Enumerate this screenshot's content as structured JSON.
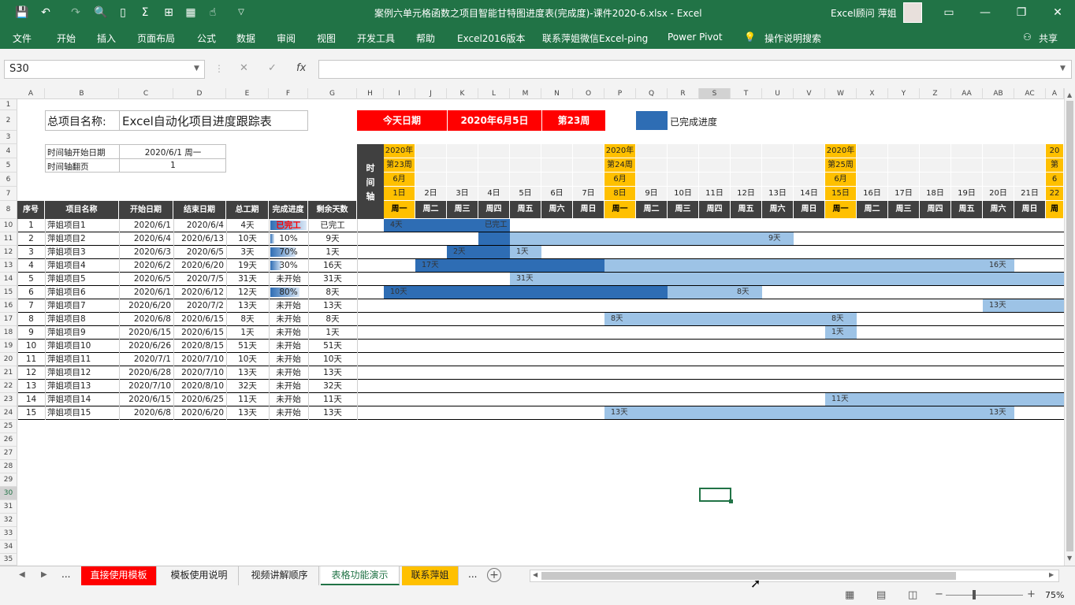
{
  "window": {
    "title": "案例六单元格函数之项目智能甘特图进度表(完成度)-课件2020-6.xlsx  -  Excel",
    "user": "Excel顾问 萍姐"
  },
  "ribbon": {
    "tabs": [
      "文件",
      "开始",
      "插入",
      "页面布局",
      "公式",
      "数据",
      "审阅",
      "视图",
      "开发工具",
      "帮助",
      "Excel2016版本",
      "联系萍姐微信Excel-ping",
      "Power Pivot"
    ],
    "search": "操作说明搜索",
    "share": "共享"
  },
  "formula": {
    "namebox": "S30",
    "fx": "fx",
    "value": ""
  },
  "columns": [
    "A",
    "B",
    "C",
    "D",
    "E",
    "F",
    "G",
    "H",
    "I",
    "J",
    "K",
    "L",
    "M",
    "N",
    "O",
    "P",
    "Q",
    "R",
    "S",
    "T",
    "U",
    "V",
    "W",
    "X",
    "Y",
    "Z",
    "AA",
    "AB",
    "AC",
    "A"
  ],
  "rows": [
    "1",
    "2",
    "3",
    "4",
    "5",
    "6",
    "7",
    "8",
    "10",
    "11",
    "12",
    "13",
    "14",
    "15",
    "16",
    "17",
    "18",
    "19",
    "20",
    "21",
    "22",
    "23",
    "24",
    "25",
    "26",
    "27",
    "28",
    "29",
    "30",
    "31",
    "32",
    "33",
    "34",
    "35"
  ],
  "sheet": {
    "project_label": "总项目名称:",
    "project_name": "Excel自动化项目进度跟踪表",
    "today_label": "今天日期",
    "today_date": "2020年6月5日",
    "today_week": "第23周",
    "legend_label": "已完成进度",
    "start_label": "时间轴开始日期",
    "start_value": "2020/6/1 周一",
    "page_label": "时间轴翻页",
    "page_value": "1",
    "timeline_label": "时\n间\n轴"
  },
  "table": {
    "headers": [
      "序号",
      "项目名称",
      "开始日期",
      "结束日期",
      "总工期",
      "完成进度",
      "剩余天数"
    ],
    "rows": [
      {
        "no": "1",
        "name": "萍姐项目1",
        "start": "2020/6/1",
        "end": "2020/6/4",
        "days": "4天",
        "pct": "已完工",
        "pct_fill": 1.0,
        "remain": "已完工"
      },
      {
        "no": "2",
        "name": "萍姐项目2",
        "start": "2020/6/4",
        "end": "2020/6/13",
        "days": "10天",
        "pct": "10%",
        "pct_fill": 0.1,
        "remain": "9天"
      },
      {
        "no": "3",
        "name": "萍姐项目3",
        "start": "2020/6/3",
        "end": "2020/6/5",
        "days": "3天",
        "pct": "70%",
        "pct_fill": 0.7,
        "remain": "1天"
      },
      {
        "no": "4",
        "name": "萍姐项目4",
        "start": "2020/6/2",
        "end": "2020/6/20",
        "days": "19天",
        "pct": "30%",
        "pct_fill": 0.3,
        "remain": "16天"
      },
      {
        "no": "5",
        "name": "萍姐项目5",
        "start": "2020/6/5",
        "end": "2020/7/5",
        "days": "31天",
        "pct": "未开始",
        "pct_fill": 0,
        "remain": "31天"
      },
      {
        "no": "6",
        "name": "萍姐项目6",
        "start": "2020/6/1",
        "end": "2020/6/12",
        "days": "12天",
        "pct": "80%",
        "pct_fill": 0.8,
        "remain": "8天"
      },
      {
        "no": "7",
        "name": "萍姐项目7",
        "start": "2020/6/20",
        "end": "2020/7/2",
        "days": "13天",
        "pct": "未开始",
        "pct_fill": 0,
        "remain": "13天"
      },
      {
        "no": "8",
        "name": "萍姐项目8",
        "start": "2020/6/8",
        "end": "2020/6/15",
        "days": "8天",
        "pct": "未开始",
        "pct_fill": 0,
        "remain": "8天"
      },
      {
        "no": "9",
        "name": "萍姐项目9",
        "start": "2020/6/15",
        "end": "2020/6/15",
        "days": "1天",
        "pct": "未开始",
        "pct_fill": 0,
        "remain": "1天"
      },
      {
        "no": "10",
        "name": "萍姐项目10",
        "start": "2020/6/26",
        "end": "2020/8/15",
        "days": "51天",
        "pct": "未开始",
        "pct_fill": 0,
        "remain": "51天"
      },
      {
        "no": "11",
        "name": "萍姐项目11",
        "start": "2020/7/1",
        "end": "2020/7/10",
        "days": "10天",
        "pct": "未开始",
        "pct_fill": 0,
        "remain": "10天"
      },
      {
        "no": "12",
        "name": "萍姐项目12",
        "start": "2020/6/28",
        "end": "2020/7/10",
        "days": "13天",
        "pct": "未开始",
        "pct_fill": 0,
        "remain": "13天"
      },
      {
        "no": "13",
        "name": "萍姐项目13",
        "start": "2020/7/10",
        "end": "2020/8/10",
        "days": "32天",
        "pct": "未开始",
        "pct_fill": 0,
        "remain": "32天"
      },
      {
        "no": "14",
        "name": "萍姐项目14",
        "start": "2020/6/15",
        "end": "2020/6/25",
        "days": "11天",
        "pct": "未开始",
        "pct_fill": 0,
        "remain": "11天"
      },
      {
        "no": "15",
        "name": "萍姐项目15",
        "start": "2020/6/8",
        "end": "2020/6/20",
        "days": "13天",
        "pct": "未开始",
        "pct_fill": 0,
        "remain": "13天"
      }
    ]
  },
  "gantt": {
    "days": [
      {
        "year": "2020年",
        "week": "第23周",
        "month": "6月",
        "day": "1日",
        "wd": "周一"
      },
      {
        "year": "",
        "week": "",
        "month": "",
        "day": "2日",
        "wd": "周二"
      },
      {
        "year": "",
        "week": "",
        "month": "",
        "day": "3日",
        "wd": "周三"
      },
      {
        "year": "",
        "week": "",
        "month": "",
        "day": "4日",
        "wd": "周四"
      },
      {
        "year": "",
        "week": "",
        "month": "",
        "day": "5日",
        "wd": "周五"
      },
      {
        "year": "",
        "week": "",
        "month": "",
        "day": "6日",
        "wd": "周六"
      },
      {
        "year": "",
        "week": "",
        "month": "",
        "day": "7日",
        "wd": "周日"
      },
      {
        "year": "2020年",
        "week": "第24周",
        "month": "6月",
        "day": "8日",
        "wd": "周一"
      },
      {
        "year": "",
        "week": "",
        "month": "",
        "day": "9日",
        "wd": "周二"
      },
      {
        "year": "",
        "week": "",
        "month": "",
        "day": "10日",
        "wd": "周三"
      },
      {
        "year": "",
        "week": "",
        "month": "",
        "day": "11日",
        "wd": "周四"
      },
      {
        "year": "",
        "week": "",
        "month": "",
        "day": "12日",
        "wd": "周五"
      },
      {
        "year": "",
        "week": "",
        "month": "",
        "day": "13日",
        "wd": "周六"
      },
      {
        "year": "",
        "week": "",
        "month": "",
        "day": "14日",
        "wd": "周日"
      },
      {
        "year": "2020年",
        "week": "第25周",
        "month": "6月",
        "day": "15日",
        "wd": "周一"
      },
      {
        "year": "",
        "week": "",
        "month": "",
        "day": "16日",
        "wd": "周二"
      },
      {
        "year": "",
        "week": "",
        "month": "",
        "day": "17日",
        "wd": "周三"
      },
      {
        "year": "",
        "week": "",
        "month": "",
        "day": "18日",
        "wd": "周四"
      },
      {
        "year": "",
        "week": "",
        "month": "",
        "day": "19日",
        "wd": "周五"
      },
      {
        "year": "",
        "week": "",
        "month": "",
        "day": "20日",
        "wd": "周六"
      },
      {
        "year": "",
        "week": "",
        "month": "",
        "day": "21日",
        "wd": "周日"
      },
      {
        "year": "20",
        "week": "第",
        "month": "6",
        "day": "22",
        "wd": "周"
      }
    ],
    "bars": [
      {
        "row": 0,
        "done_from": 1,
        "done_to": 4,
        "rem_from": 0,
        "rem_to": 0,
        "done_label": "4天",
        "rem_label": "已完工",
        "rem_label_day": 4
      },
      {
        "row": 1,
        "done_from": 4,
        "done_to": 4,
        "rem_from": 5,
        "rem_to": 13,
        "done_label": "",
        "rem_label": "9天",
        "rem_label_day": 13
      },
      {
        "row": 2,
        "done_from": 3,
        "done_to": 4,
        "rem_from": 5,
        "rem_to": 5,
        "done_label": "2天",
        "rem_label": "1天",
        "rem_label_day": 5
      },
      {
        "row": 3,
        "done_from": 2,
        "done_to": 7,
        "rem_from": 8,
        "rem_to": 20,
        "done_label": "17天",
        "rem_label": "16天",
        "rem_label_day": 20
      },
      {
        "row": 4,
        "done_from": 0,
        "done_to": 0,
        "rem_from": 5,
        "rem_to": 22,
        "done_label": "",
        "rem_label": "31天",
        "rem_label_day": 5
      },
      {
        "row": 5,
        "done_from": 1,
        "done_to": 9,
        "rem_from": 10,
        "rem_to": 12,
        "done_label": "10天",
        "rem_label": "8天",
        "rem_label_day": 12
      },
      {
        "row": 6,
        "done_from": 0,
        "done_to": 0,
        "rem_from": 20,
        "rem_to": 22,
        "done_label": "",
        "rem_label": "13天",
        "rem_label_day": 20
      },
      {
        "row": 7,
        "done_from": 0,
        "done_to": 0,
        "rem_from": 8,
        "rem_to": 15,
        "done_label": "",
        "rem_label": "8天",
        "rem_label_day": 8,
        "rem_label2": "8天",
        "rem_label2_day": 15
      },
      {
        "row": 8,
        "done_from": 0,
        "done_to": 0,
        "rem_from": 15,
        "rem_to": 15,
        "done_label": "",
        "rem_label": "1天",
        "rem_label_day": 15
      },
      {
        "row": 13,
        "done_from": 0,
        "done_to": 0,
        "rem_from": 15,
        "rem_to": 22,
        "done_label": "",
        "rem_label": "11天",
        "rem_label_day": 15
      },
      {
        "row": 14,
        "done_from": 0,
        "done_to": 0,
        "rem_from": 8,
        "rem_to": 20,
        "done_label": "",
        "rem_label": "13天",
        "rem_label_day": 8,
        "rem_label2": "13天",
        "rem_label2_day": 20
      }
    ]
  },
  "sheettabs": {
    "tabs": [
      "直接使用模板",
      "模板使用说明",
      "视频讲解顺序",
      "表格功能演示",
      "联系萍姐"
    ],
    "more": "...",
    "active": "表格功能演示"
  },
  "status": {
    "zoom": "75%"
  },
  "colors": {
    "ribbon": "#217346",
    "done": "#2e6db4",
    "remain": "#9dc3e6",
    "header": "#404040",
    "red": "#ff0000",
    "gold": "#ffc000"
  }
}
